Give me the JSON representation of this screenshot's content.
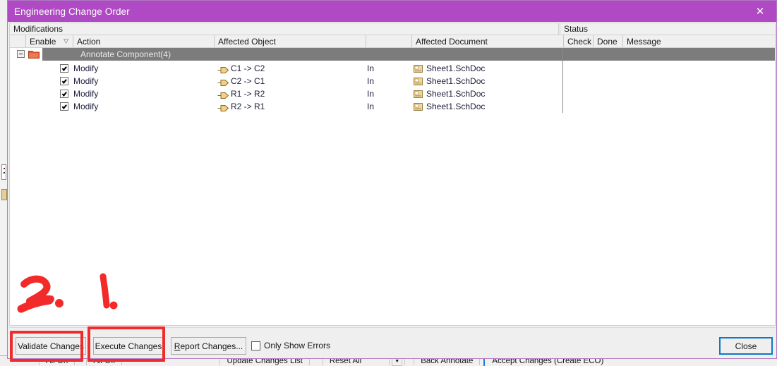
{
  "window": {
    "title": "Engineering Change Order",
    "close_icon": "close-icon",
    "titlebar_color": "#b04ac4"
  },
  "panels": {
    "modifications_label": "Modifications",
    "status_label": "Status"
  },
  "grid": {
    "columns": [
      {
        "key": "handle",
        "label": ""
      },
      {
        "key": "enable",
        "label": "Enable",
        "sort_glyph": "▽"
      },
      {
        "key": "action",
        "label": "Action"
      },
      {
        "key": "affected_object",
        "label": "Affected Object"
      },
      {
        "key": "direction",
        "label": ""
      },
      {
        "key": "affected_document",
        "label": "Affected Document"
      },
      {
        "key": "check",
        "label": "Check"
      },
      {
        "key": "done",
        "label": "Done"
      },
      {
        "key": "message",
        "label": "Message"
      }
    ],
    "group": {
      "label": "Annotate Component(4)",
      "expander": "collapse-icon",
      "icon": "folder-icon",
      "selected": true
    },
    "rows": [
      {
        "enable": true,
        "action": "Modify",
        "affected_object": "C1 -> C2",
        "direction": "In",
        "affected_document": "Sheet1.SchDoc",
        "check": "",
        "done": "",
        "message": "",
        "object_icon": "component-pin-icon",
        "doc_icon": "schematic-document-icon"
      },
      {
        "enable": true,
        "action": "Modify",
        "affected_object": "C2 -> C1",
        "direction": "In",
        "affected_document": "Sheet1.SchDoc",
        "check": "",
        "done": "",
        "message": "",
        "object_icon": "component-pin-icon",
        "doc_icon": "schematic-document-icon"
      },
      {
        "enable": true,
        "action": "Modify",
        "affected_object": "R1 -> R2",
        "direction": "In",
        "affected_document": "Sheet1.SchDoc",
        "check": "",
        "done": "",
        "message": "",
        "object_icon": "component-pin-icon",
        "doc_icon": "schematic-document-icon"
      },
      {
        "enable": true,
        "action": "Modify",
        "affected_object": "R2 -> R1",
        "direction": "In",
        "affected_document": "Sheet1.SchDoc",
        "check": "",
        "done": "",
        "message": "",
        "object_icon": "component-pin-icon",
        "doc_icon": "schematic-document-icon"
      }
    ]
  },
  "footer": {
    "validate_button": "Validate Changes",
    "execute_button": "Execute Changes",
    "report_button_prefix": "R",
    "report_button_rest": "eport Changes...",
    "only_show_errors_label": "Only Show Errors",
    "only_show_errors_checked": false,
    "close_button": "Close"
  },
  "annotations": {
    "mark_1": "1.",
    "mark_2": "2.",
    "highlight_color": "#ef2b2b",
    "highlight_1_target": "Validate Changes",
    "highlight_2_target": "Execute Changes"
  },
  "background_bar": {
    "items": [
      "All On",
      "All Off",
      "Update Changes List",
      "Reset All",
      "Back Annotate",
      "Accept Changes (Create ECO)"
    ],
    "dropdown_icon": "caret-down-icon"
  }
}
